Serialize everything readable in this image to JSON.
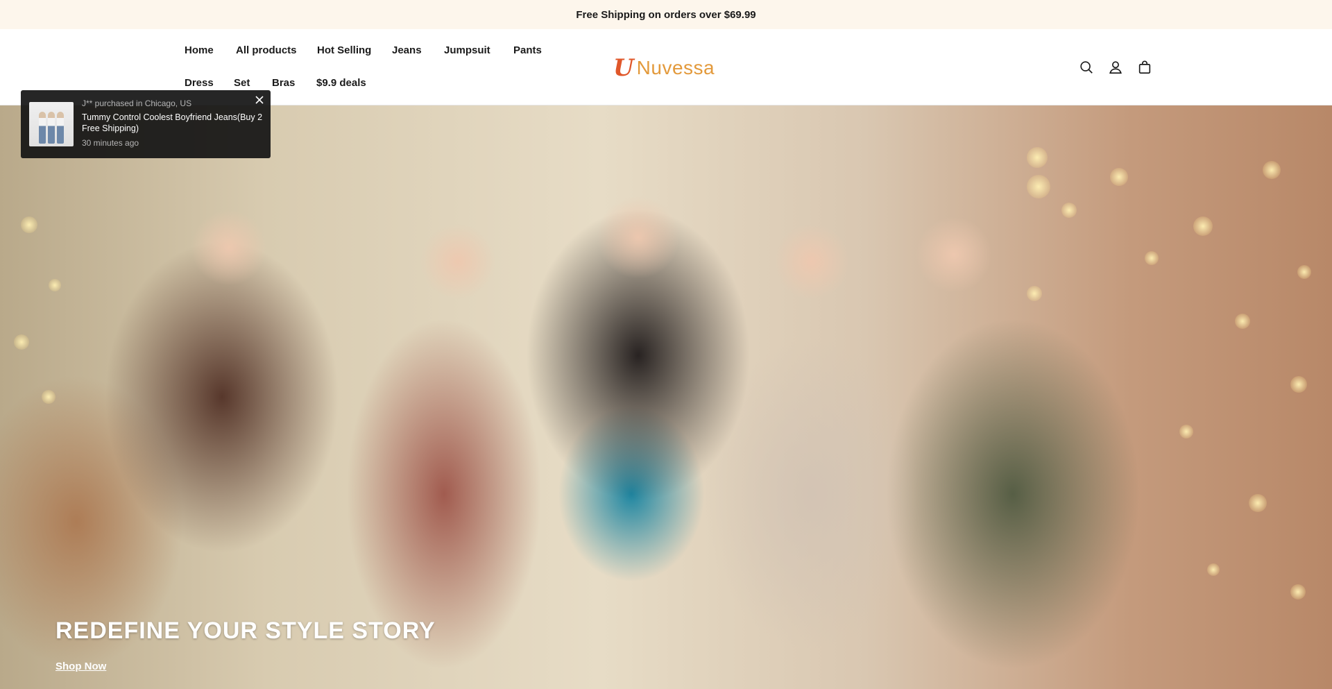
{
  "announcement": {
    "text": "Free Shipping on orders over $69.99"
  },
  "nav": {
    "items": [
      {
        "label": "Home"
      },
      {
        "label": "All products"
      },
      {
        "label": "Hot Selling"
      },
      {
        "label": "Jeans"
      },
      {
        "label": "Jumpsuit"
      },
      {
        "label": "Pants"
      },
      {
        "label": "Dress"
      },
      {
        "label": "Set"
      },
      {
        "label": "Bras"
      },
      {
        "label": "$9.9 deals"
      }
    ]
  },
  "brand": {
    "name": "Nuvessa",
    "mark": "U",
    "colors": {
      "mark": "#e0572a",
      "text": "#e39a3c"
    }
  },
  "header_icons": [
    "search-icon",
    "account-icon",
    "cart-icon"
  ],
  "hero": {
    "title": "REDEFINE YOUR STYLE STORY",
    "cta": "Shop Now"
  },
  "purchase_toast": {
    "meta": "J** purchased in Chicago, US",
    "product": "Tummy Control Coolest Boyfriend Jeans(Buy 2 Free Shipping)",
    "time": "30 minutes ago"
  }
}
